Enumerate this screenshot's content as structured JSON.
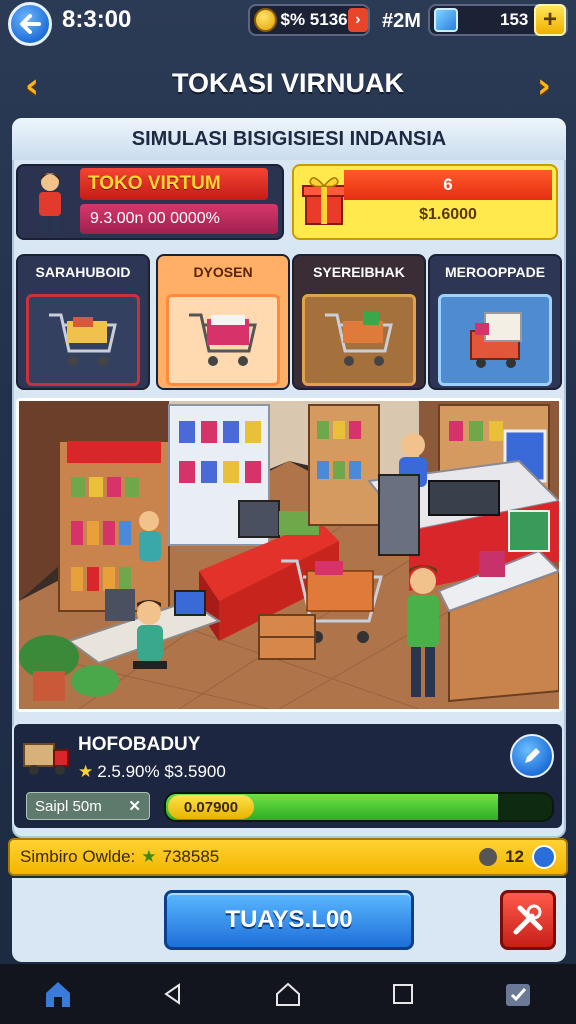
{
  "status": {
    "time": "8:3:00",
    "coins": "$%  5136",
    "gems": "#2M",
    "energy": "153"
  },
  "header": {
    "title": "TOKASI VIRNUAK",
    "subtitle": "SIMULASI BISIGISIESI INDANSIA"
  },
  "store": {
    "name": "TOKO VIRTUM",
    "stats": "9.3.00n 00 0000%"
  },
  "reward": {
    "top": "6",
    "bottom": "$1.6000"
  },
  "categories": [
    {
      "label": "SARAHUBOID",
      "bg": "#c8323c"
    },
    {
      "label": "DYOSEN",
      "bg": "#ff8a3d"
    },
    {
      "label": "SYEREIBHAK",
      "bg": "#8c4a24"
    },
    {
      "label": "MEROOPPADE",
      "bg": "#2b6bb0"
    }
  ],
  "upgrade": {
    "title": "HOFOBADUY",
    "details": "2.5.90% $3.5900",
    "sap_label": "Saipl 50m",
    "progress_label": "0.07900",
    "progress": 0.86
  },
  "footer_bar": {
    "left_label": "Simbiro Owlde:",
    "left_value": "738585",
    "right_value": "12"
  },
  "actions": {
    "main_label": "TUAYS.L00"
  },
  "colors": {
    "accent_blue": "#1e6fd9",
    "accent_yellow": "#ffd233",
    "accent_red": "#e52f12",
    "panel": "#d8e7f3"
  }
}
